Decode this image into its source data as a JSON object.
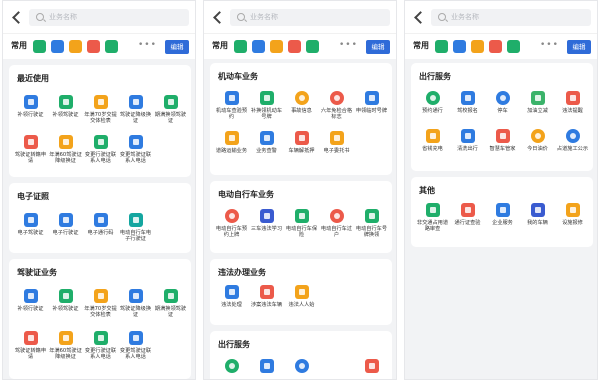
{
  "search_placeholder": "业务名称",
  "common_label": "常用",
  "edit_label": "编辑",
  "more_label": "•••",
  "panel1": {
    "recent": {
      "title": "最近使用",
      "items": [
        "补领行驶证",
        "补领驾驶证",
        "年满70岁交提交体检表",
        "驾驶证降级换证",
        "期满换领驾驶证",
        "驾驶证转籍申请",
        "年满60驾驶证降级换证",
        "变更行驶证联系人电话",
        "变更驾驶证联系人电话"
      ]
    },
    "ecert": {
      "title": "电子证照",
      "items": [
        "电子驾驶证",
        "电子行驶证",
        "电子通行码",
        "电动自行车电子行驶证"
      ]
    },
    "license": {
      "title": "驾驶证业务",
      "items": [
        "补领行驶证",
        "补领驾驶证",
        "年满70岁交提交体检表",
        "驾驶证降级换证",
        "期满换领驾驶证",
        "驾驶证转籍申请",
        "年满60驾驶证降级换证",
        "变更行驶证联系人电话",
        "变更驾驶证联系人电话"
      ]
    }
  },
  "panel2": {
    "motor": {
      "title": "机动车业务",
      "items": [
        "机动车查验预约",
        "补换领机动车号牌",
        "事故信息",
        "六年免检合格标志",
        "申领临时号牌",
        "道路运输业务",
        "业务查警",
        "车辆解抵押",
        "电子委托书"
      ]
    },
    "ebike": {
      "title": "电动自行车业务",
      "items": [
        "电动自行车预约上牌",
        "三车违法学习",
        "电动自行车保险",
        "电动自行车过户",
        "电动自行车号牌换领"
      ]
    },
    "violation": {
      "title": "违法办理业务",
      "items": [
        "违法处理",
        "涉案违法车辆",
        "违法人人始"
      ]
    },
    "travel_partial": {
      "title": "出行服务"
    }
  },
  "panel3": {
    "travel": {
      "title": "出行服务",
      "items": [
        "预约通行",
        "驾校报名",
        "停车",
        "加油立减",
        "违法提醒",
        "省钱充电",
        "清洗出行",
        "智慧车管家",
        "今日油价",
        "占道施工公示"
      ]
    },
    "other": {
      "title": "其他",
      "items": [
        "非交通占用道路审查",
        "通行证查验",
        "企业服务",
        "我的车辆",
        "设施报修"
      ]
    }
  }
}
